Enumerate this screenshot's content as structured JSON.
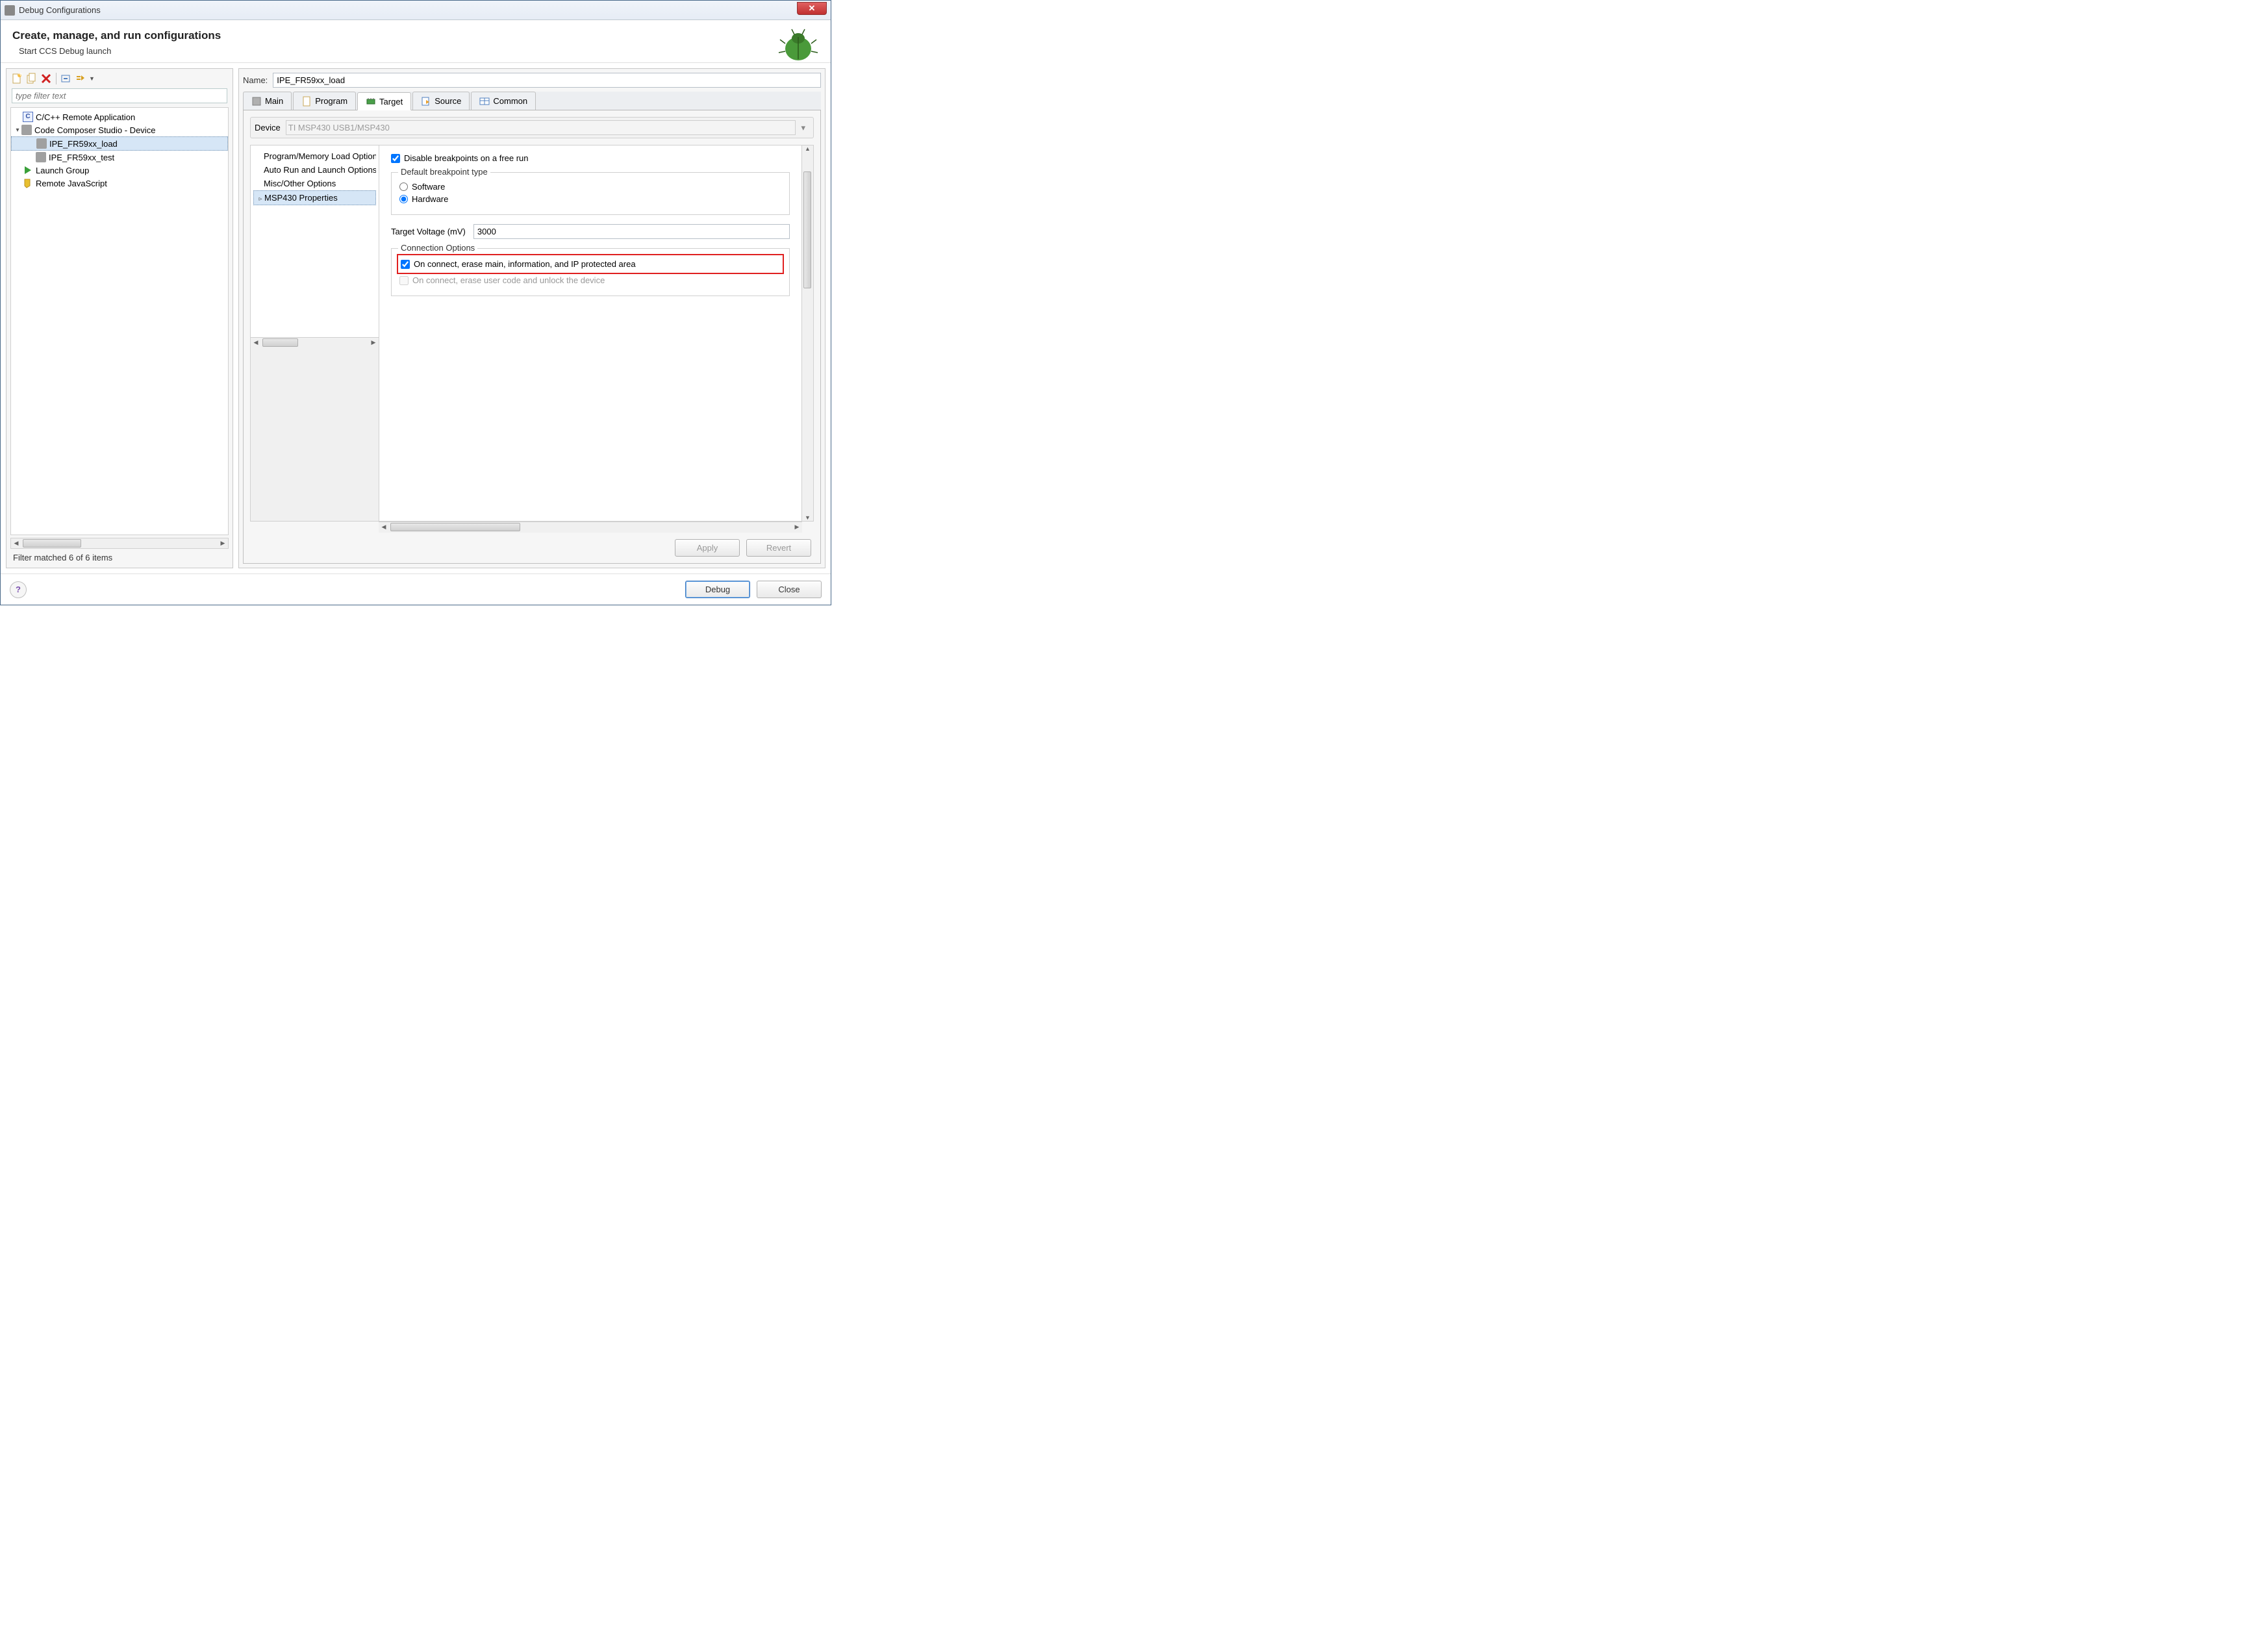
{
  "window": {
    "title": "Debug Configurations"
  },
  "header": {
    "title": "Create, manage, and run configurations",
    "subtitle": "Start CCS Debug launch"
  },
  "filter": {
    "placeholder": "type filter text"
  },
  "tree": {
    "items": [
      {
        "label": "C/C++ Remote Application",
        "icon": "c"
      },
      {
        "label": "Code Composer Studio - Device",
        "icon": "box",
        "expanded": true,
        "children": [
          {
            "label": "IPE_FR59xx_load",
            "icon": "box",
            "selected": true
          },
          {
            "label": "IPE_FR59xx_test",
            "icon": "box"
          }
        ]
      },
      {
        "label": "Launch Group",
        "icon": "play"
      },
      {
        "label": "Remote JavaScript",
        "icon": "js"
      }
    ]
  },
  "left_status": "Filter matched 6 of 6 items",
  "name": {
    "label": "Name:",
    "value": "IPE_FR59xx_load"
  },
  "tabs": [
    {
      "label": "Main",
      "active": false
    },
    {
      "label": "Program",
      "active": false
    },
    {
      "label": "Target",
      "active": true
    },
    {
      "label": "Source",
      "active": false
    },
    {
      "label": "Common",
      "active": false
    }
  ],
  "device": {
    "label": "Device",
    "value": "TI MSP430 USB1/MSP430"
  },
  "prop_tree": [
    {
      "label": "Program/Memory Load Options"
    },
    {
      "label": "Auto Run and Launch Options"
    },
    {
      "label": "Misc/Other Options"
    },
    {
      "label": "MSP430 Properties",
      "selected": true,
      "expandable": true
    }
  ],
  "settings": {
    "disable_bp": {
      "label": "Disable breakpoints on a free run",
      "checked": true
    },
    "default_bp_legend": "Default breakpoint type",
    "bp_software": "Software",
    "bp_hardware": "Hardware",
    "bp_selected": "hardware",
    "target_voltage_label": "Target Voltage (mV)",
    "target_voltage_value": "3000",
    "conn_legend": "Connection Options",
    "conn_erase_main": {
      "label": "On connect, erase main, information, and IP protected area",
      "checked": true
    },
    "conn_erase_user": {
      "label": "On connect, erase user code and unlock the device",
      "checked": false,
      "disabled": true
    }
  },
  "buttons": {
    "apply": "Apply",
    "revert": "Revert",
    "debug": "Debug",
    "close": "Close"
  }
}
